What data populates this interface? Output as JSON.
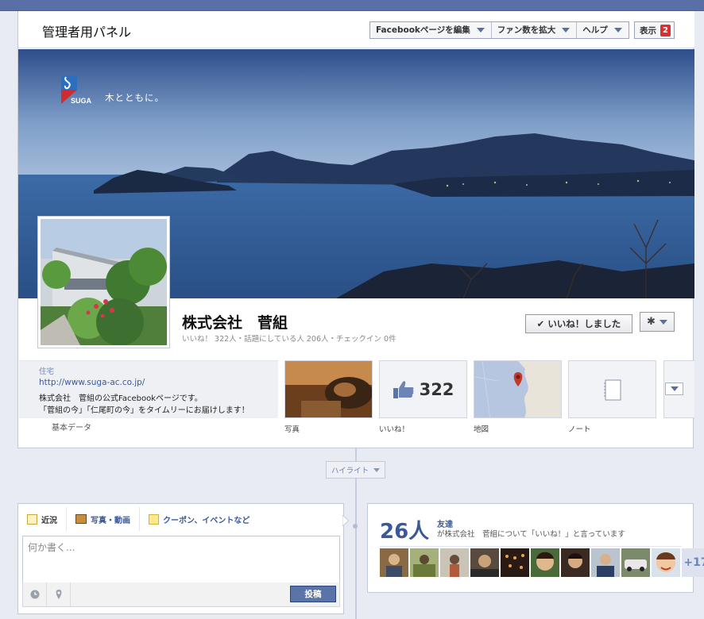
{
  "admin": {
    "title": "管理者用パネル",
    "menu": [
      "Facebookページを編集",
      "ファン数を拡大",
      "ヘルプ"
    ],
    "view_label": "表示",
    "view_badge": "2"
  },
  "cover": {
    "logo_text": "SUGA",
    "tagline": "木とともに。"
  },
  "page": {
    "name": "株式会社　菅組",
    "stats": "いいね！ 322人・話題にしている人 206人・チェックイン 0件",
    "like_button": "いいね！しました"
  },
  "about": {
    "label": "住宅",
    "url": "http://www.suga-ac.co.jp/",
    "line1": "株式会社　菅組の公式Facebookページです。",
    "line2": "「菅組の今」「仁尾町の今」をタイムリーにお届けします！",
    "section_label": "基本データ"
  },
  "tiles": {
    "photos_label": "写真",
    "likes_label": "いいね！",
    "likes_count": "322",
    "map_label": "地図",
    "notes_label": "ノート"
  },
  "highlight_label": "ハイライト",
  "composer": {
    "tab_status": "近況",
    "tab_photo": "写真・動画",
    "tab_coupon": "クーポン、イベントなど",
    "placeholder": "何か書く...",
    "post_button": "投稿"
  },
  "friends": {
    "count": "26人",
    "label": "友達",
    "text": "が株式会社　菅組について「いいね！」と言っています",
    "more": "+17"
  },
  "colors": {
    "accent": "#3b5998",
    "badge": "#d9302f",
    "brand_logo": "#d12a2f"
  }
}
